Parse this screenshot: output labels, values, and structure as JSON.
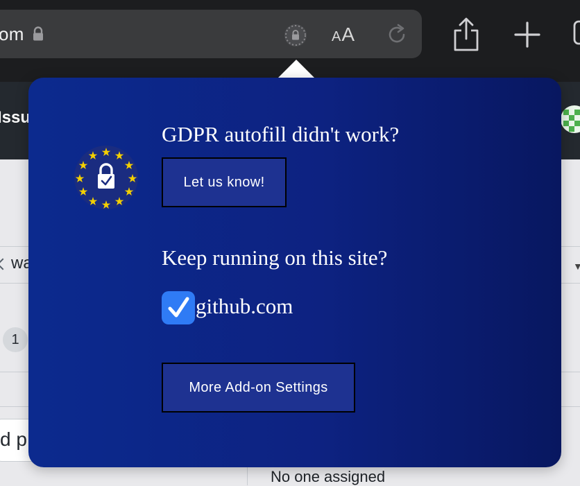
{
  "browser": {
    "url_fragment": "om",
    "aa_label_small": "A",
    "aa_label_large": "A"
  },
  "page": {
    "title_fragment": "Issu",
    "branch_fragment": "wa",
    "counter": "1",
    "input_fragment": "d p",
    "assignee_text": "No one assigned"
  },
  "popover": {
    "feedback_heading": "GDPR autofill didn't work?",
    "feedback_button": "Let us know!",
    "keep_running_heading": "Keep running on this site?",
    "site": "github.com",
    "site_enabled": true,
    "settings_button": "More Add-on Settings",
    "colors": {
      "background_start": "#0c2a8e",
      "background_end": "#081760",
      "button_bg": "#1e3291",
      "checkbox": "#2f7bf5",
      "stars": "#f5d000"
    }
  }
}
